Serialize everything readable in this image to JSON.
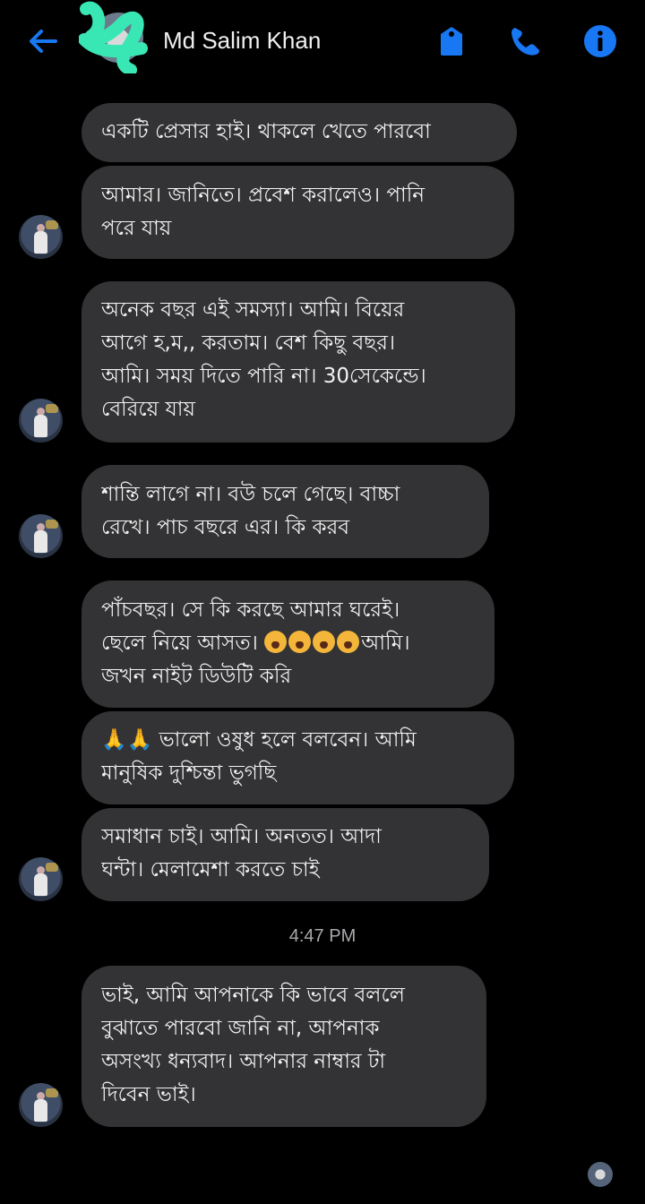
{
  "header": {
    "contact_name": "Md Salim Khan",
    "icons": [
      "back-arrow-icon",
      "tag-icon",
      "phone-icon",
      "info-icon"
    ],
    "accent_color": "#1877f2"
  },
  "messages": [
    {
      "lines": [
        "একটি প্রেসার হাই। থাকলে খেতে পারবো"
      ]
    },
    {
      "lines": [
        "আমার। জানিতে। প্রবেশ করালেও। পানি",
        "পরে যায়"
      ]
    },
    {
      "lines": [
        "অনেক বছর এই সমস্যা। আমি। বিয়ের",
        "আগে  হ,ম,, করতাম।   বেশ কিছু বছর।",
        "আমি। সময় দিতে পারি না। 30সেকেন্ডে।",
        "বেরিয়ে যায়"
      ]
    },
    {
      "lines": [
        "শান্তি লাগে না। বউ চলে গেছে।   বাচ্চা",
        "রেখে।   পাচ বছরে  এর।  কি করব"
      ]
    },
    {
      "lines": [
        "পাঁচবছর। সে কি করছে আমার ঘরেই।",
        "ছেলে নিয়ে আসত।",
        "জখন নাইট ডিউটি করি"
      ],
      "line2_suffix": "আমি।"
    },
    {
      "lines": [
        "ভালো ওষুধ হলে বলবেন।    আমি",
        "মানুষিক দুশ্চিন্তা ভুগছি"
      ],
      "prefix": "🙏🙏"
    },
    {
      "lines": [
        "সমাধান চাই।      আমি। অনতত। আদা",
        "ঘন্টা।   মেলামেশা করতে চাই"
      ]
    },
    {
      "lines": [
        "ভাই, আমি আপনাকে কি ভাবে বললে",
        "বুঝাতে পারবো জানি না, আপনাক",
        "অসংখ্য ধন্যবাদ।  আপনার নাম্বার টা",
        "দিবেন ভাই।"
      ]
    }
  ],
  "timestamp": "4:47 PM"
}
